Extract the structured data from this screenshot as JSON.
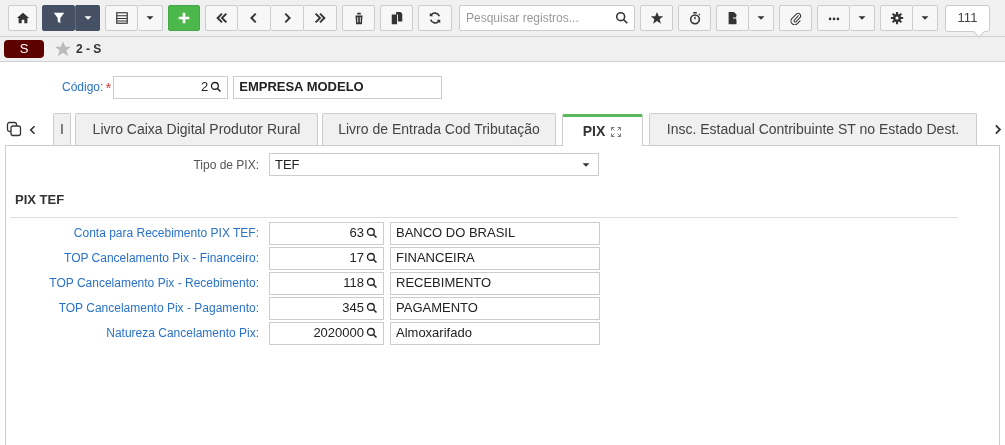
{
  "toolbar": {
    "search": {
      "placeholder": "Pesquisar registros..."
    },
    "counter": "111"
  },
  "record": {
    "tag": "S",
    "title": "2 - S",
    "favorite": false
  },
  "header_field": {
    "label": "Código:",
    "required_mark": "*",
    "code": "2",
    "description": "EMPRESA MODELO"
  },
  "tabs": [
    {
      "label": "I",
      "selected": false
    },
    {
      "label": "Livro Caixa Digital Produtor Rural",
      "selected": false
    },
    {
      "label": "Livro de Entrada Cod Tributação",
      "selected": false
    },
    {
      "label": "PIX",
      "selected": true
    },
    {
      "label": "Insc. Estadual Contribuinte ST no Estado Dest.",
      "selected": false
    }
  ],
  "tipo_pix": {
    "label": "Tipo de PIX:",
    "value": "TEF"
  },
  "section": {
    "title": "PIX TEF"
  },
  "rows": [
    {
      "label": "Conta para Recebimento PIX TEF:",
      "code": "63",
      "description": "BANCO DO BRASIL"
    },
    {
      "label": "TOP Cancelamento Pix - Financeiro:",
      "code": "17",
      "description": "FINANCEIRA"
    },
    {
      "label": "TOP Cancelamento Pix - Recebimento:",
      "code": "118",
      "description": "RECEBIMENTO"
    },
    {
      "label": "TOP Cancelamento Pix - Pagamento:",
      "code": "345",
      "description": "PAGAMENTO"
    },
    {
      "label": "Natureza Cancelamento Pix:",
      "code": "2020000",
      "description": "Almoxarifado"
    }
  ]
}
